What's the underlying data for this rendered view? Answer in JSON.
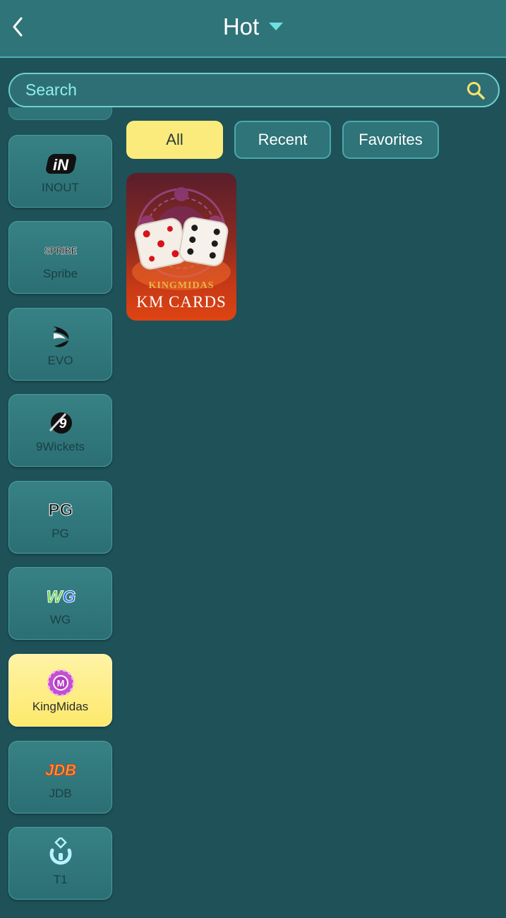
{
  "header": {
    "title": "Hot",
    "back_icon": "chevron-left-icon",
    "dropdown_icon": "caret-down-icon"
  },
  "search": {
    "placeholder": "Search",
    "icon": "search-icon"
  },
  "tabs": [
    {
      "label": "All",
      "active": true
    },
    {
      "label": "Recent",
      "active": false
    },
    {
      "label": "Favorites",
      "active": false
    }
  ],
  "providers": [
    {
      "label": "INOUT",
      "logo_text": "iN",
      "icon": "inout-logo-icon",
      "active": false
    },
    {
      "label": "Spribe",
      "logo_text": "SPRIBE",
      "icon": "spribe-logo-icon",
      "active": false
    },
    {
      "label": "EVO",
      "icon": "evo-logo-icon",
      "active": false
    },
    {
      "label": "9Wickets",
      "logo_text": "9",
      "icon": "9wickets-logo-icon",
      "active": false
    },
    {
      "label": "PG",
      "logo_text": "PG",
      "icon": "pg-logo-icon",
      "active": false
    },
    {
      "label": "WG",
      "logo_text": "WG",
      "icon": "wg-logo-icon",
      "active": false
    },
    {
      "label": "KingMidas",
      "logo_text": "M",
      "icon": "kingmidas-logo-icon",
      "active": true
    },
    {
      "label": "JDB",
      "logo_text": "JDB",
      "icon": "jdb-logo-icon",
      "active": false
    },
    {
      "label": "T1",
      "icon": "t1-logo-icon",
      "active": false
    }
  ],
  "games": [
    {
      "brand": "KINGMIDAS",
      "name": "KM CARDS"
    }
  ],
  "colors": {
    "background": "#1e5158",
    "header": "#2f7479",
    "accent_yellow": "#fbeb7c",
    "search_text": "#8ff0ee"
  }
}
